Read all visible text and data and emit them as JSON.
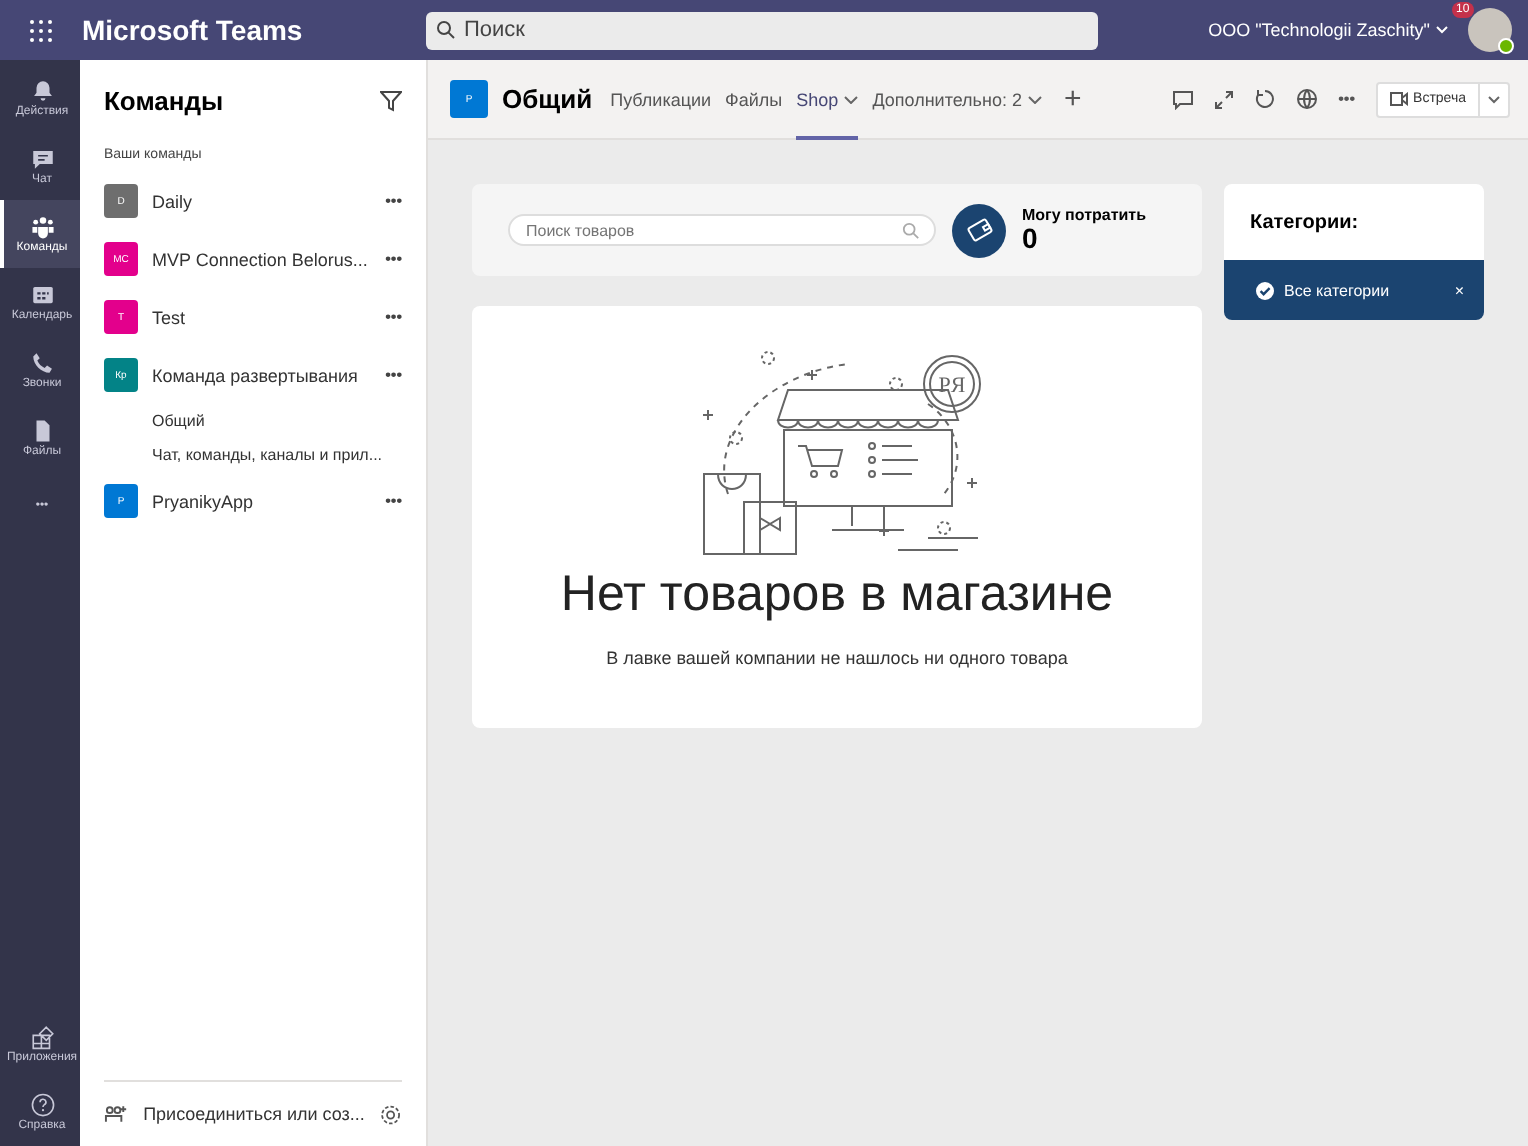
{
  "app_bar": {
    "title": "Microsoft Teams",
    "search": {
      "placeholder": "Поиск"
    },
    "org": "ООО \"Technologii Zaschity\"",
    "badge": "10"
  },
  "rail": {
    "items": [
      {
        "label": "Действия",
        "selected": false
      },
      {
        "label": "Чат",
        "selected": false
      },
      {
        "label": "Команды",
        "selected": true
      },
      {
        "label": "Календарь",
        "selected": false
      },
      {
        "label": "Звонки",
        "selected": false
      },
      {
        "label": "Файлы",
        "selected": false
      },
      {
        "label": "•••",
        "selected": false
      }
    ],
    "bottom": [
      {
        "label": "Приложения",
        "selected": false
      },
      {
        "label": "Справка",
        "selected": false
      }
    ]
  },
  "teams_pane": {
    "title": "Команды",
    "section": "Ваши команды",
    "teams": [
      {
        "initials": "D",
        "name": "Daily",
        "color": "#6e6e6e",
        "more": "•••"
      },
      {
        "initials": "MC",
        "name": "MVP Connection Belorus...",
        "color": "#e3008c",
        "more": "•••"
      },
      {
        "initials": "T",
        "name": "Test",
        "color": "#e3008c",
        "more": "•••"
      },
      {
        "initials": "Кр",
        "name": "Команда развертывания",
        "color": "#038387",
        "more": "•••",
        "children": [
          {
            "name": "Общий"
          },
          {
            "name": "Чат, команды, каналы и прил..."
          }
        ]
      },
      {
        "initials": "P",
        "name": "PryanikyApp",
        "color": "#0078d4",
        "more": "•••"
      }
    ],
    "join": "Присоединиться или соз..."
  },
  "channel": {
    "initials": "P",
    "name": "Общий",
    "tabs": [
      {
        "label": "Публикации",
        "selected": false,
        "caret": false
      },
      {
        "label": "Файлы",
        "selected": false,
        "caret": false
      },
      {
        "label": "Shop",
        "selected": true,
        "caret": true
      },
      {
        "label": "Дополнительно: 2",
        "selected": false,
        "caret": true
      }
    ],
    "add": "+",
    "more": "•••",
    "meet": "Встреча"
  },
  "shop": {
    "search": {
      "placeholder": "Поиск товаров"
    },
    "balance_label": "Могу потратить",
    "balance": "0",
    "empty_logo": "PЯ",
    "empty_title": "Нет товаров в магазине",
    "empty_text": "В лавке вашей компании не нашлось ни одного товара",
    "categories": {
      "title": "Категории:",
      "items": [
        {
          "label": "Все категории",
          "selected": true,
          "close": "×"
        }
      ]
    }
  }
}
